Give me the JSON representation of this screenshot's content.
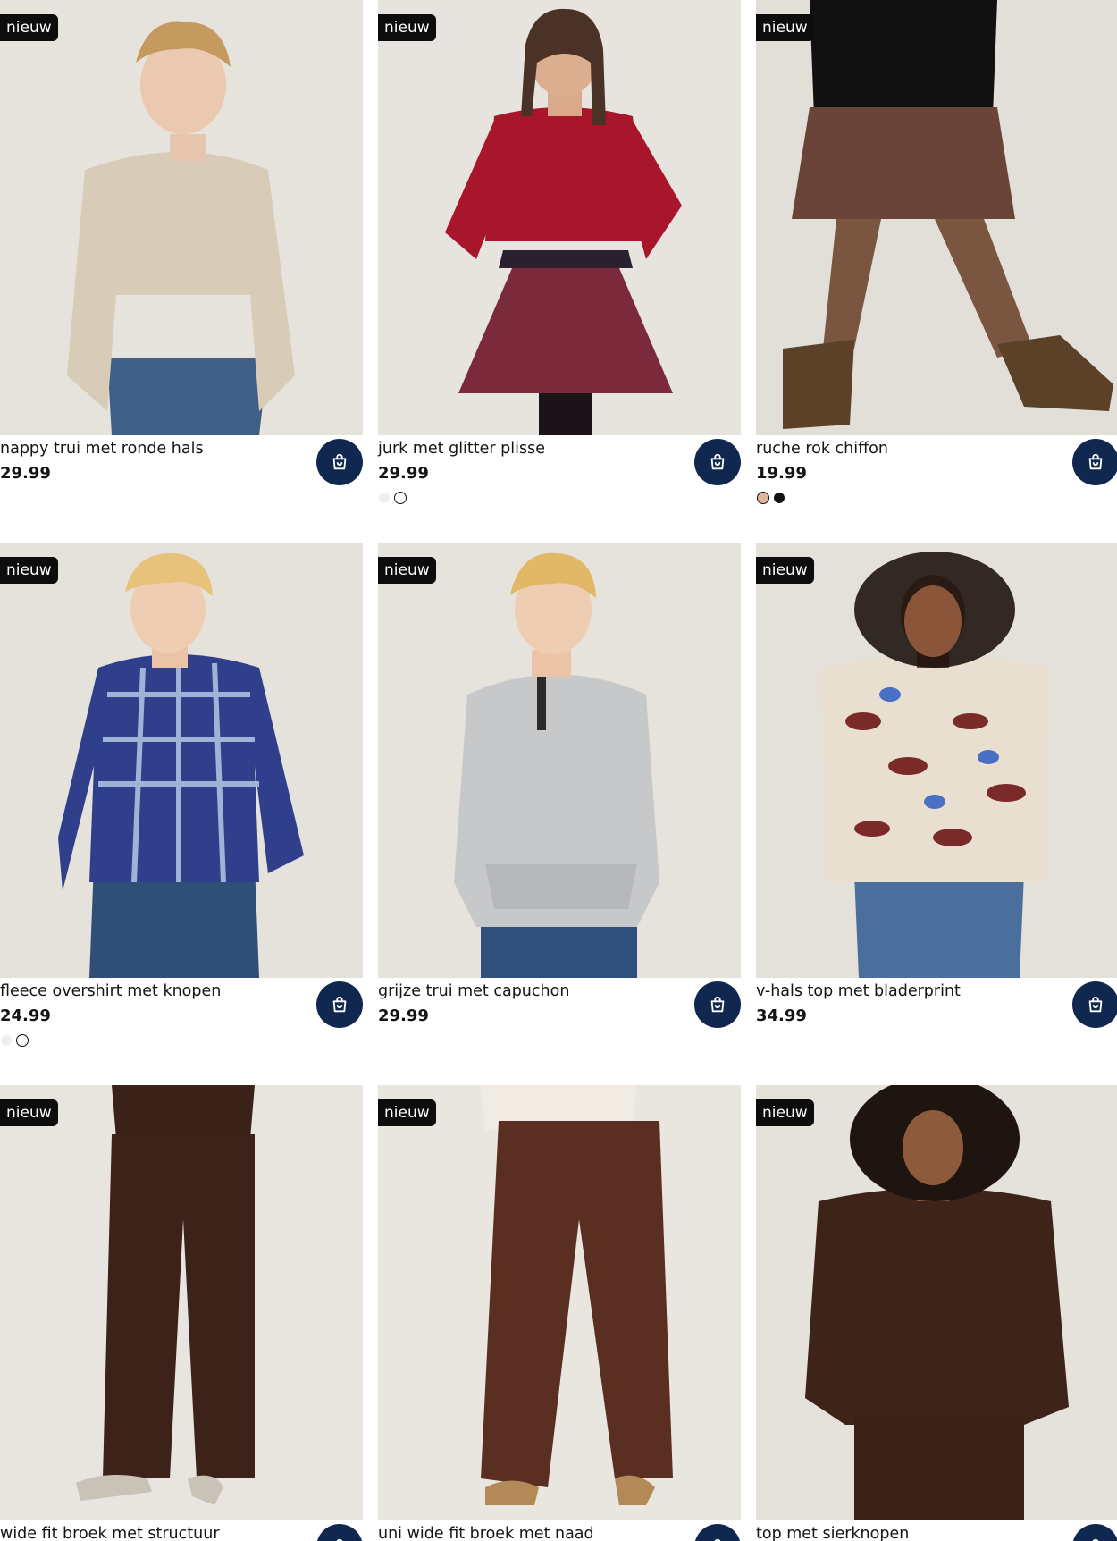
{
  "products": [
    {
      "badge": "nieuw",
      "name": "nappy trui met ronde hals",
      "price": "29.99",
      "swatches": []
    },
    {
      "badge": "nieuw",
      "name": "jurk met glitter plisse",
      "price": "29.99",
      "swatches": [
        "#efefef",
        "#ffffff"
      ]
    },
    {
      "badge": "nieuw",
      "name": "ruche rok chiffon",
      "price": "19.99",
      "swatches": [
        "#e0b49a",
        "#111111"
      ]
    },
    {
      "badge": "nieuw",
      "name": "fleece overshirt met knopen",
      "price": "24.99",
      "swatches": [
        "#efefef",
        "#ffffff"
      ]
    },
    {
      "badge": "nieuw",
      "name": "grijze trui met capuchon",
      "price": "29.99",
      "swatches": []
    },
    {
      "badge": "nieuw",
      "name": "v-hals top met bladerprint",
      "price": "34.99",
      "swatches": []
    },
    {
      "badge": "nieuw",
      "name": "wide fit broek met structuur",
      "price": "",
      "swatches": []
    },
    {
      "badge": "nieuw",
      "name": "uni wide fit broek met naad",
      "price": "",
      "swatches": []
    },
    {
      "badge": "nieuw",
      "name": "top met sierknopen",
      "price": "",
      "swatches": []
    }
  ],
  "colors": {
    "cart_button": "#10284f",
    "badge_bg": "#0d0d0d",
    "photo_bg": "#e7e3de"
  },
  "icons": {
    "cart": "shopping-bag-icon"
  }
}
